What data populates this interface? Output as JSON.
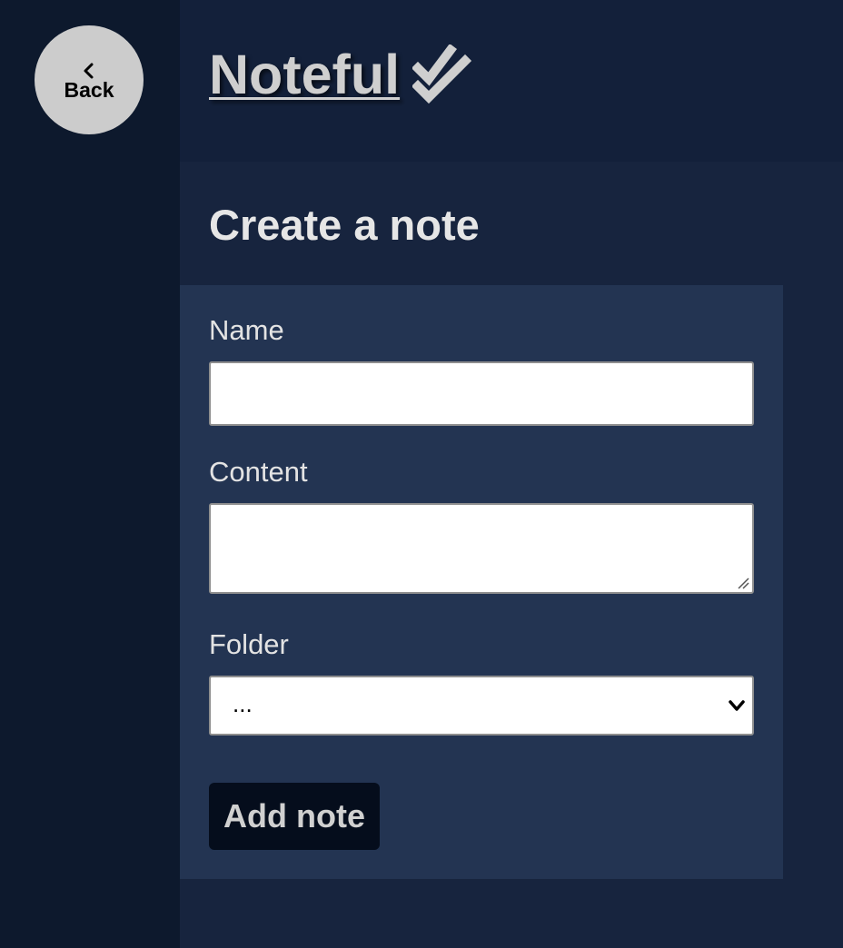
{
  "sidebar": {
    "back_label": "Back"
  },
  "header": {
    "title": "Noteful"
  },
  "main": {
    "title": "Create a note",
    "form": {
      "name_label": "Name",
      "name_value": "",
      "content_label": "Content",
      "content_value": "",
      "folder_label": "Folder",
      "folder_selected": "...",
      "submit_label": "Add note"
    }
  },
  "icons": {
    "back": "chevron-left-icon",
    "logo": "double-check-icon",
    "folder_dropdown": "chevron-down-icon"
  },
  "colors": {
    "sidebar_bg": "#0d192d",
    "header_bg": "#13203a",
    "main_bg": "#17243e",
    "form_bg": "#233452",
    "back_button_bg": "#cccccc",
    "submit_bg": "#050d1c",
    "title_text": "#cfcfcf"
  }
}
